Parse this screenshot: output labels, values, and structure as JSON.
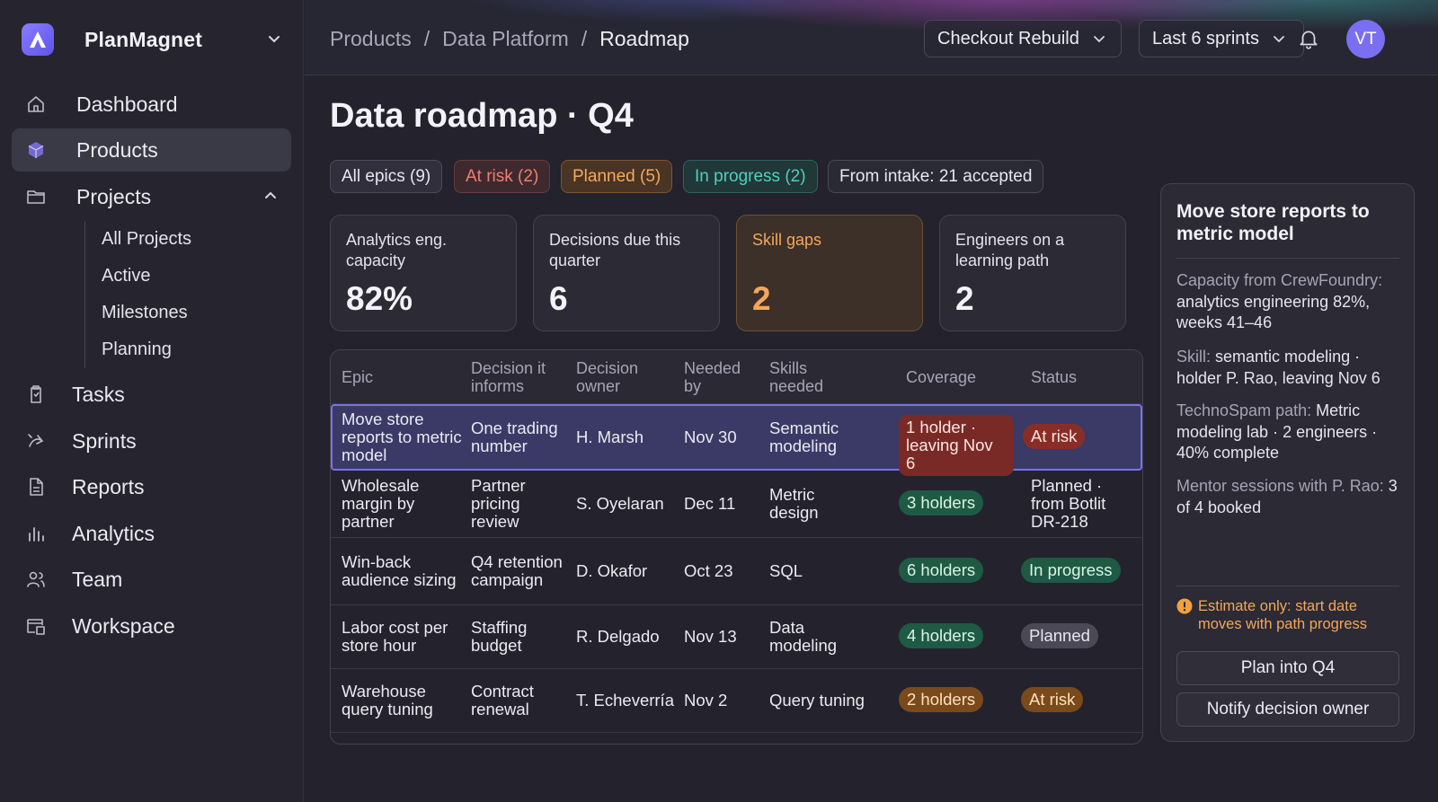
{
  "app": {
    "name": "PlanMagnet",
    "user_initials": "VT"
  },
  "sidebar": {
    "items": [
      {
        "label": "Dashboard",
        "icon": "home-icon"
      },
      {
        "label": "Products",
        "icon": "cube-icon",
        "active": true
      },
      {
        "label": "Projects",
        "icon": "folder-icon",
        "expanded": true
      },
      {
        "label": "Tasks",
        "icon": "clipboard-icon"
      },
      {
        "label": "Sprints",
        "icon": "sprint-icon"
      },
      {
        "label": "Reports",
        "icon": "document-icon"
      },
      {
        "label": "Analytics",
        "icon": "bar-chart-icon"
      },
      {
        "label": "Team",
        "icon": "people-icon"
      },
      {
        "label": "Workspace",
        "icon": "workspace-icon"
      }
    ],
    "projects_sub": [
      "All Projects",
      "Active",
      "Milestones",
      "Planning"
    ]
  },
  "header": {
    "breadcrumb": [
      "Products",
      "Data Platform",
      "Roadmap"
    ],
    "project_select": "Checkout Rebuild",
    "range_select": "Last 6 sprints"
  },
  "page": {
    "title": "Data roadmap · Q4"
  },
  "filters": [
    {
      "label": "All epics (9)",
      "style": "default"
    },
    {
      "label": "At risk (2)",
      "style": "red"
    },
    {
      "label": "Planned (5)",
      "style": "orange"
    },
    {
      "label": "In progress (2)",
      "style": "teal"
    },
    {
      "label": "From intake: 21 accepted",
      "style": "plain"
    }
  ],
  "stats": [
    {
      "label": "Analytics eng. capacity",
      "value": "82%"
    },
    {
      "label": "Decisions due this quarter",
      "value": "6"
    },
    {
      "label": "Skill gaps",
      "value": "2",
      "highlight": true
    },
    {
      "label": "Engineers on a learning path",
      "value": "2"
    }
  ],
  "table": {
    "columns": [
      "Epic",
      "Decision it informs",
      "Decision owner",
      "Needed by",
      "Skills needed",
      "Coverage",
      "Status"
    ],
    "rows": [
      {
        "epic": "Move store reports to metric model",
        "decision": "One trading number",
        "owner": "H. Marsh",
        "needed": "Nov 30",
        "skills": "Semantic modeling",
        "coverage": "1 holder · leaving Nov 6",
        "coverage_style": "red",
        "status": "At risk",
        "status_style": "red-s",
        "selected": true
      },
      {
        "epic": "Wholesale margin by partner",
        "decision": "Partner pricing review",
        "owner": "S. Oyelaran",
        "needed": "Dec 11",
        "skills": "Metric design",
        "coverage": "3 holders",
        "coverage_style": "green",
        "status": "Planned · from Botlit DR-218",
        "status_style": "text"
      },
      {
        "epic": "Win-back audience sizing",
        "decision": "Q4 retention campaign",
        "owner": "D. Okafor",
        "needed": "Oct 23",
        "skills": "SQL",
        "coverage": "6 holders",
        "coverage_style": "green",
        "status": "In progress",
        "status_style": "green"
      },
      {
        "epic": "Labor cost per store hour",
        "decision": "Staffing budget",
        "owner": "R. Delgado",
        "needed": "Nov 13",
        "skills": "Data modeling",
        "coverage": "4 holders",
        "coverage_style": "green",
        "status": "Planned",
        "status_style": "grey"
      },
      {
        "epic": "Warehouse query tuning",
        "decision": "Contract renewal",
        "owner": "T. Echeverría",
        "needed": "Nov 2",
        "skills": "Query tuning",
        "coverage": "2 holders",
        "coverage_style": "orange",
        "status": "At risk",
        "status_style": "orange"
      }
    ]
  },
  "panel": {
    "title": "Move store reports to metric model",
    "capacity_label": "Capacity from CrewFoundry:",
    "capacity_text": "analytics engineering 82%, weeks 41–46",
    "skill_label": "Skill:",
    "skill_text": "semantic modeling · holder P. Rao, leaving Nov 6",
    "path_label": "TechnoSpam path:",
    "path_text": "Metric modeling lab · 2 engineers · 40% complete",
    "mentor_label": "Mentor sessions with P. Rao:",
    "mentor_text": "3 of 4 booked",
    "estimate": "Estimate only: start date moves with path progress",
    "primary_button": "Plan into Q4",
    "secondary_button": "Notify decision owner"
  },
  "colors": {
    "accent": "#7a6ff0",
    "risk": "#f07e72",
    "planned": "#f5a95a",
    "progress": "#4fd0bd"
  }
}
